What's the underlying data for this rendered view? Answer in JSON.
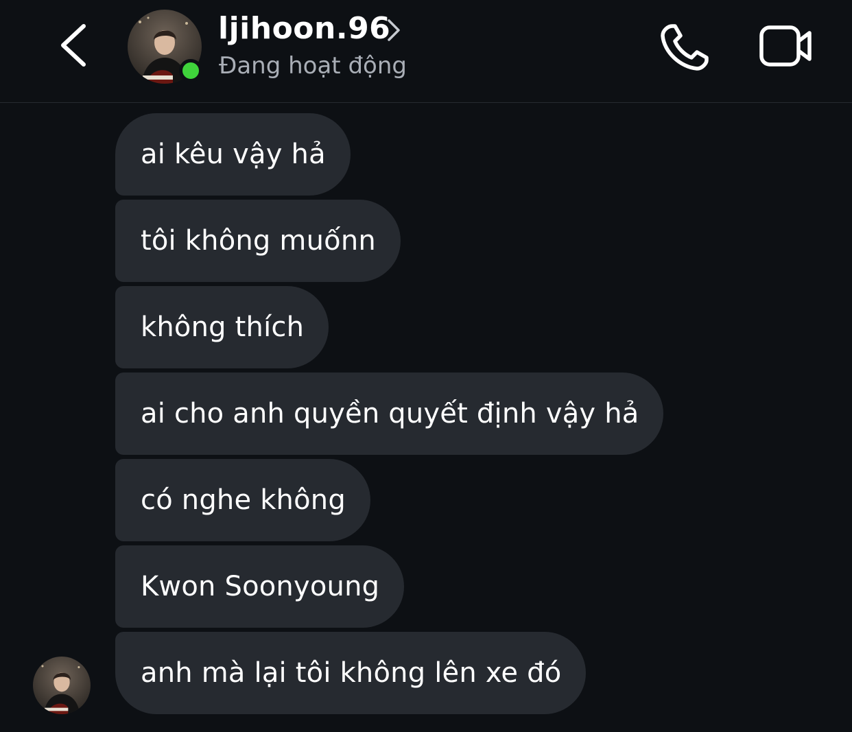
{
  "header": {
    "contact_name": "ljihoon.96",
    "status": "Đang hoạt động",
    "icons": {
      "back": "chevron-left-icon",
      "profile": "chevron-right-icon",
      "call": "phone-icon",
      "video": "video-camera-icon"
    },
    "online_color": "#3fd33b"
  },
  "messages": [
    {
      "text": "ai kêu vậy hả"
    },
    {
      "text": "tôi không muốnn"
    },
    {
      "text": "không thích"
    },
    {
      "text": "ai cho anh quyền quyết định vậy hả"
    },
    {
      "text": "có nghe không"
    },
    {
      "text": "Kwon Soonyoung"
    },
    {
      "text": "anh mà lại tôi không lên xe đó"
    }
  ],
  "colors": {
    "background": "#0d1014",
    "bubble": "#262a30",
    "status_text": "#a9aeb6"
  }
}
